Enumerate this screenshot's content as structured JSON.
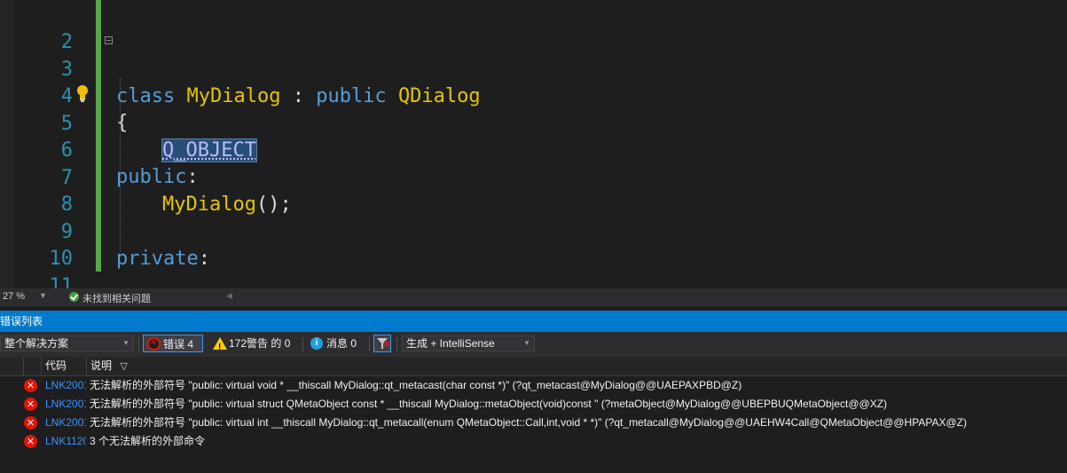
{
  "editor": {
    "lines": [
      {
        "num": "2"
      },
      {
        "num": "3"
      },
      {
        "num": "4"
      },
      {
        "num": "5"
      },
      {
        "num": "6"
      },
      {
        "num": "7"
      },
      {
        "num": "8"
      },
      {
        "num": "9"
      },
      {
        "num": "10"
      },
      {
        "num": "11"
      }
    ],
    "tokens": {
      "l3_class": "class",
      "l3_name": "MyDialog",
      "l3_colon": " : ",
      "l3_public": "public",
      "l3_base": "QDialog",
      "l4_brace": "{",
      "l5_macro": "Q_OBJECT",
      "l6_public": "public",
      "l6_colon": ":",
      "l7_ctor": "MyDialog",
      "l7_rest": "();",
      "l9_private": "private",
      "l9_colon": ":",
      "l11_close": "};"
    },
    "colors": {
      "keyword": "#569cd6",
      "type": "#e5c400",
      "macro": "#beb7ff",
      "line_number": "#2b91af",
      "change_bar": "#57a64a"
    }
  },
  "status": {
    "zoom": "27 %",
    "issues_text": "未找到相关问题",
    "ok_icon": "check-circle-icon"
  },
  "error_list": {
    "title": "错误列表",
    "scope_select": "整个解决方案",
    "errors_label": "错误 4",
    "warnings_label": "172警告 的 0",
    "messages_label": "消息 0",
    "build_select": "生成 + IntelliSense",
    "columns": {
      "code": "代码",
      "description": "说明"
    },
    "rows": [
      {
        "code": "LNK2001",
        "description": "无法解析的外部符号 \"public: virtual void * __thiscall MyDialog::qt_metacast(char const *)\" (?qt_metacast@MyDialog@@UAEPAXPBD@Z)"
      },
      {
        "code": "LNK2001",
        "description": "无法解析的外部符号 \"public: virtual struct QMetaObject const * __thiscall MyDialog::metaObject(void)const \" (?metaObject@MyDialog@@UBEPBUQMetaObject@@XZ)"
      },
      {
        "code": "LNK2001",
        "description": "无法解析的外部符号 \"public: virtual int __thiscall MyDialog::qt_metacall(enum QMetaObject::Call,int,void * *)\" (?qt_metacall@MyDialog@@UAEHW4Call@QMetaObject@@HPAPAX@Z)"
      },
      {
        "code": "LNK1120",
        "description": "3 个无法解析的外部命令"
      }
    ],
    "accent": "#007acc",
    "error_color": "#e51400"
  }
}
